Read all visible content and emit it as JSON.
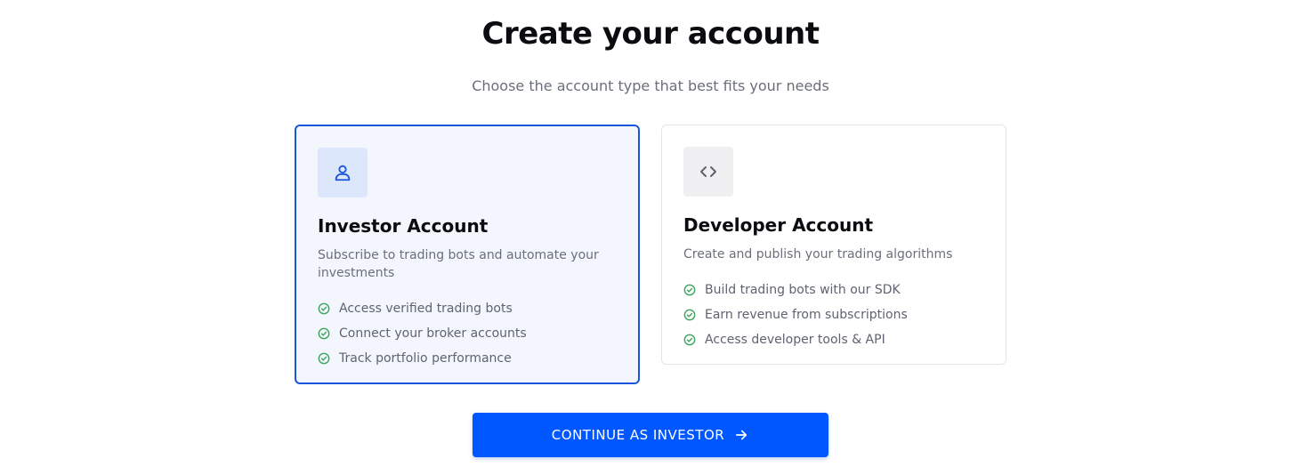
{
  "header": {
    "title": "Create your account",
    "subtitle": "Choose the account type that best fits your needs"
  },
  "cards": [
    {
      "title": "Investor Account",
      "description": "Subscribe to trading bots and automate your investments",
      "icon": "user-icon",
      "selected": true,
      "features": [
        "Access verified trading bots",
        "Connect your broker accounts",
        "Track portfolio performance"
      ]
    },
    {
      "title": "Developer Account",
      "description": "Create and publish your trading algorithms",
      "icon": "code-icon",
      "selected": false,
      "features": [
        "Build trading bots with our SDK",
        "Earn revenue from subscriptions",
        "Access developer tools & API"
      ]
    }
  ],
  "actions": {
    "continue_label": "CONTINUE AS INVESTOR"
  },
  "colors": {
    "accent": "#0057ff",
    "selected_border": "#1a56db",
    "check": "#3aa55b"
  }
}
